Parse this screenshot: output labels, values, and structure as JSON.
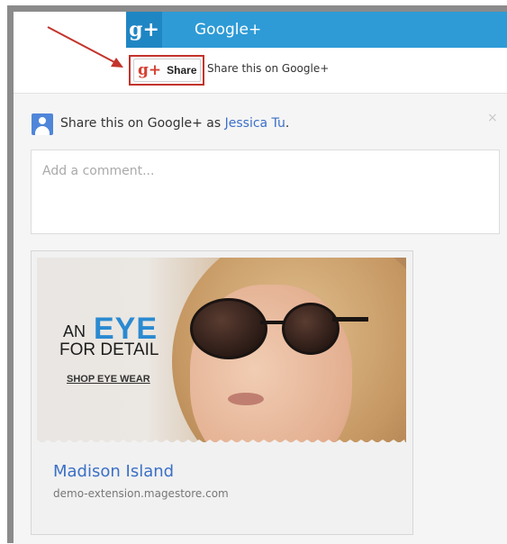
{
  "header": {
    "logo_glyph": "g+",
    "title": "Google+"
  },
  "share_button": {
    "icon_glyph": "g+",
    "label": "Share",
    "caption": "Share this on Google+"
  },
  "dialog": {
    "share_as_prefix": "Share this on Google+ as ",
    "user_name": "Jessica Tu",
    "share_as_suffix": ".",
    "close_glyph": "×",
    "comment_placeholder": "Add a comment..."
  },
  "preview": {
    "ad_an": "AN",
    "ad_eye": "EYE",
    "ad_for_detail": "FOR DETAIL",
    "ad_shop": "SHOP EYE WEAR",
    "title": "Madison Island",
    "url": "demo-extension.magestore.com"
  },
  "colors": {
    "gplus_header": "#2e9bd6",
    "highlight_border": "#c3332b",
    "link_blue": "#3b6fc7",
    "ad_accent": "#2a8ad1"
  }
}
